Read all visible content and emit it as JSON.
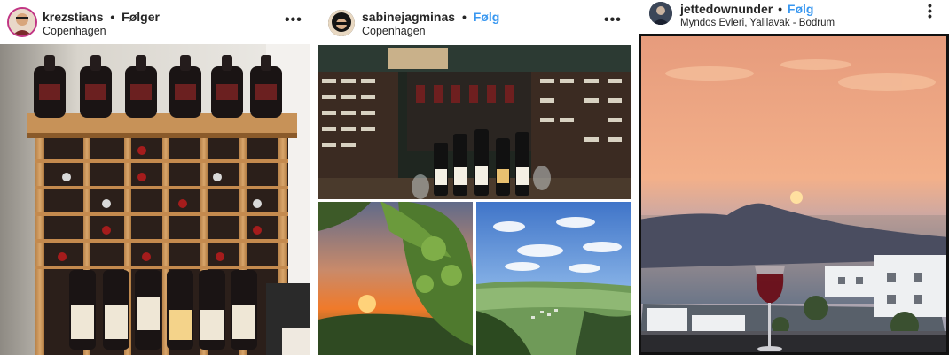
{
  "posts": [
    {
      "username": "krezstians",
      "separator": "•",
      "follow_label": "Følger",
      "location": "Copenhagen",
      "more_icon": "more-horizontal-icon",
      "photo_subject": "wine-rack"
    },
    {
      "username": "sabinejagminas",
      "separator": "•",
      "follow_label": "Følg",
      "location": "Copenhagen",
      "more_icon": "more-horizontal-icon",
      "photo_subject": "wine-collage"
    },
    {
      "username": "jettedownunder",
      "separator": "•",
      "follow_label": "Følg",
      "location": "Myndos Evleri, Yalilavak - Bodrum",
      "more_icon": "more-vertical-icon",
      "photo_subject": "sunset-with-wine"
    }
  ],
  "colors": {
    "follow_blue": "#3897f0",
    "following_text": "#262626",
    "text_primary": "#262626"
  }
}
